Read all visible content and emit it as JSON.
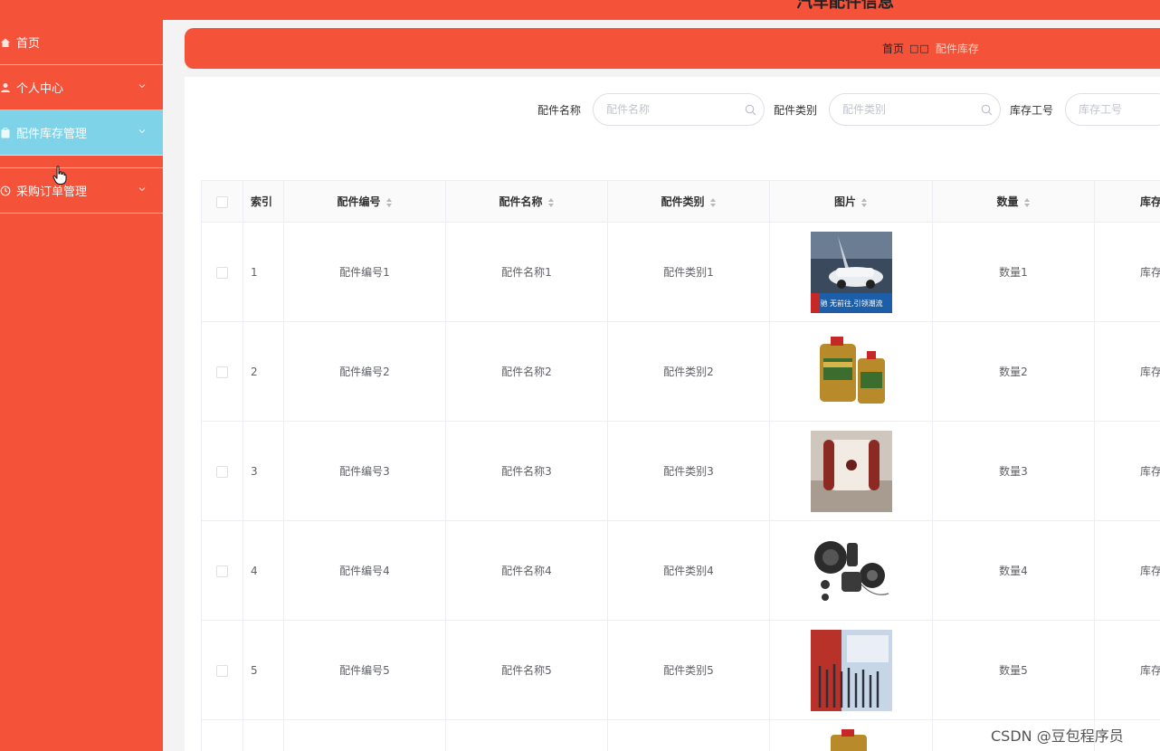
{
  "header": {
    "title": "汽车配件信息"
  },
  "sidebar": {
    "items": [
      {
        "label": "首页",
        "icon": "home-icon"
      },
      {
        "label": "个人中心",
        "icon": "user-icon"
      },
      {
        "label": "配件库存管理",
        "icon": "clipboard-icon"
      },
      {
        "label": "采购订单管理",
        "icon": "clock-icon"
      }
    ]
  },
  "breadcrumb": {
    "home": "首页",
    "separator": "□□",
    "current": "配件库存"
  },
  "search": {
    "fields": [
      {
        "label": "配件名称",
        "placeholder": "配件名称"
      },
      {
        "label": "配件类别",
        "placeholder": "配件类别"
      },
      {
        "label": "库存工号",
        "placeholder": "库存工号"
      }
    ]
  },
  "table": {
    "columns": [
      "索引",
      "配件编号",
      "配件名称",
      "配件类别",
      "图片",
      "数量",
      "库存"
    ],
    "rows": [
      {
        "index": "1",
        "code": "配件编号1",
        "name": "配件名称1",
        "category": "配件类别1",
        "image": "car-spark-plug-ad",
        "qty": "数量1",
        "stock": "库存"
      },
      {
        "index": "2",
        "code": "配件编号2",
        "name": "配件名称2",
        "category": "配件类别2",
        "image": "engine-oil-bottles",
        "qty": "数量2",
        "stock": "库存"
      },
      {
        "index": "3",
        "code": "配件编号3",
        "name": "配件名称3",
        "category": "配件类别3",
        "image": "car-seat-pillow",
        "qty": "数量3",
        "stock": "库存"
      },
      {
        "index": "4",
        "code": "配件编号4",
        "name": "配件名称4",
        "category": "配件类别4",
        "image": "car-speakers",
        "qty": "数量4",
        "stock": "库存"
      },
      {
        "index": "5",
        "code": "配件编号5",
        "name": "配件名称5",
        "category": "配件类别5",
        "image": "drill-bits-set",
        "qty": "数量5",
        "stock": "库存"
      }
    ],
    "image_text": {
      "ad_banner": "驰 无前往,引领潮流"
    }
  },
  "watermark": "CSDN @豆包程序员",
  "colors": {
    "primary": "#f5523a",
    "active_menu": "#7ed3e8",
    "border": "#ebeef5"
  }
}
